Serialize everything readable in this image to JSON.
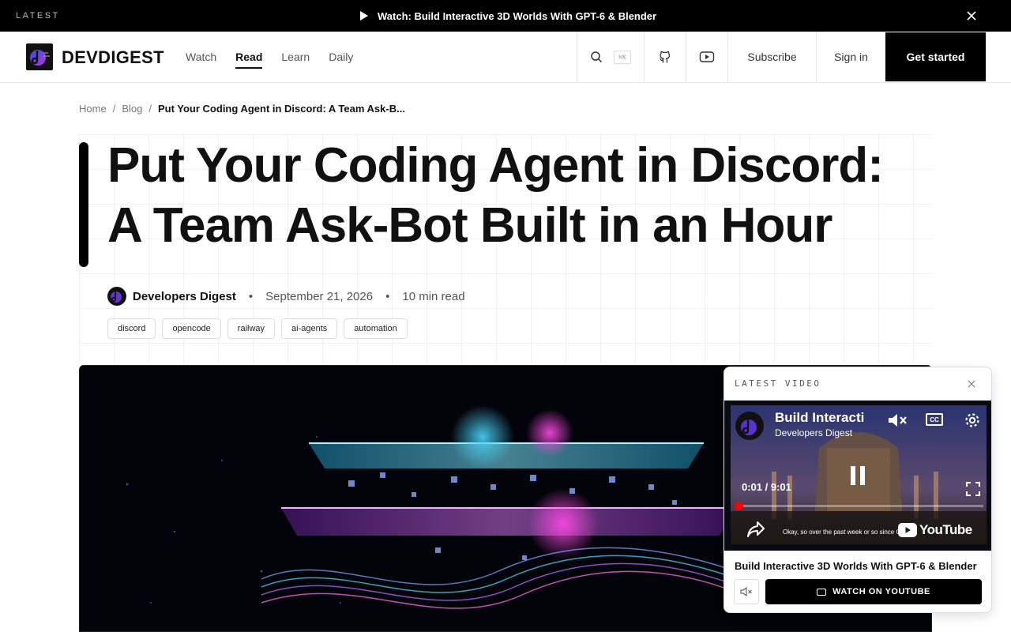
{
  "announcement": {
    "latest_label": "LATEST",
    "watch_text": "Watch: Build Interactive 3D Worlds With GPT-6 & Blender"
  },
  "header": {
    "brand": "DEVDIGEST",
    "nav": [
      {
        "label": "Watch"
      },
      {
        "label": "Read",
        "active": true
      },
      {
        "label": "Learn"
      },
      {
        "label": "Daily"
      }
    ],
    "search_shortcut": "⌘K",
    "subscribe": "Subscribe",
    "sign_in": "Sign in",
    "get_started": "Get started"
  },
  "breadcrumb": {
    "home": "Home",
    "blog": "Blog",
    "current": "Put Your Coding Agent in Discord: A Team Ask-B..."
  },
  "article": {
    "title_line1": "Put Your Coding Agent in Discord:",
    "title_line2": "A Team Ask-Bot Built in an Hour",
    "author": "Developers Digest",
    "date": "September 21, 2026",
    "read_time": "10 min read",
    "tags": [
      "discord",
      "opencode",
      "railway",
      "ai-agents",
      "automation"
    ]
  },
  "video_widget": {
    "header": "LATEST VIDEO",
    "player": {
      "title_overlay": "Build Interacti",
      "channel": "Developers Digest",
      "time": "0:01 / 9:01",
      "caption": "Okay, so over the past week or so since GPT-6",
      "caption_line2": "GPT-6",
      "cc_label": "CC",
      "youtube_label": "YouTube",
      "progress": 0.002
    },
    "video_title": "Build Interactive 3D Worlds With GPT-6 & Blender",
    "watch_button": "WATCH ON YOUTUBE"
  },
  "colors": {
    "accent": "#000000",
    "progress": "#ff0000"
  }
}
